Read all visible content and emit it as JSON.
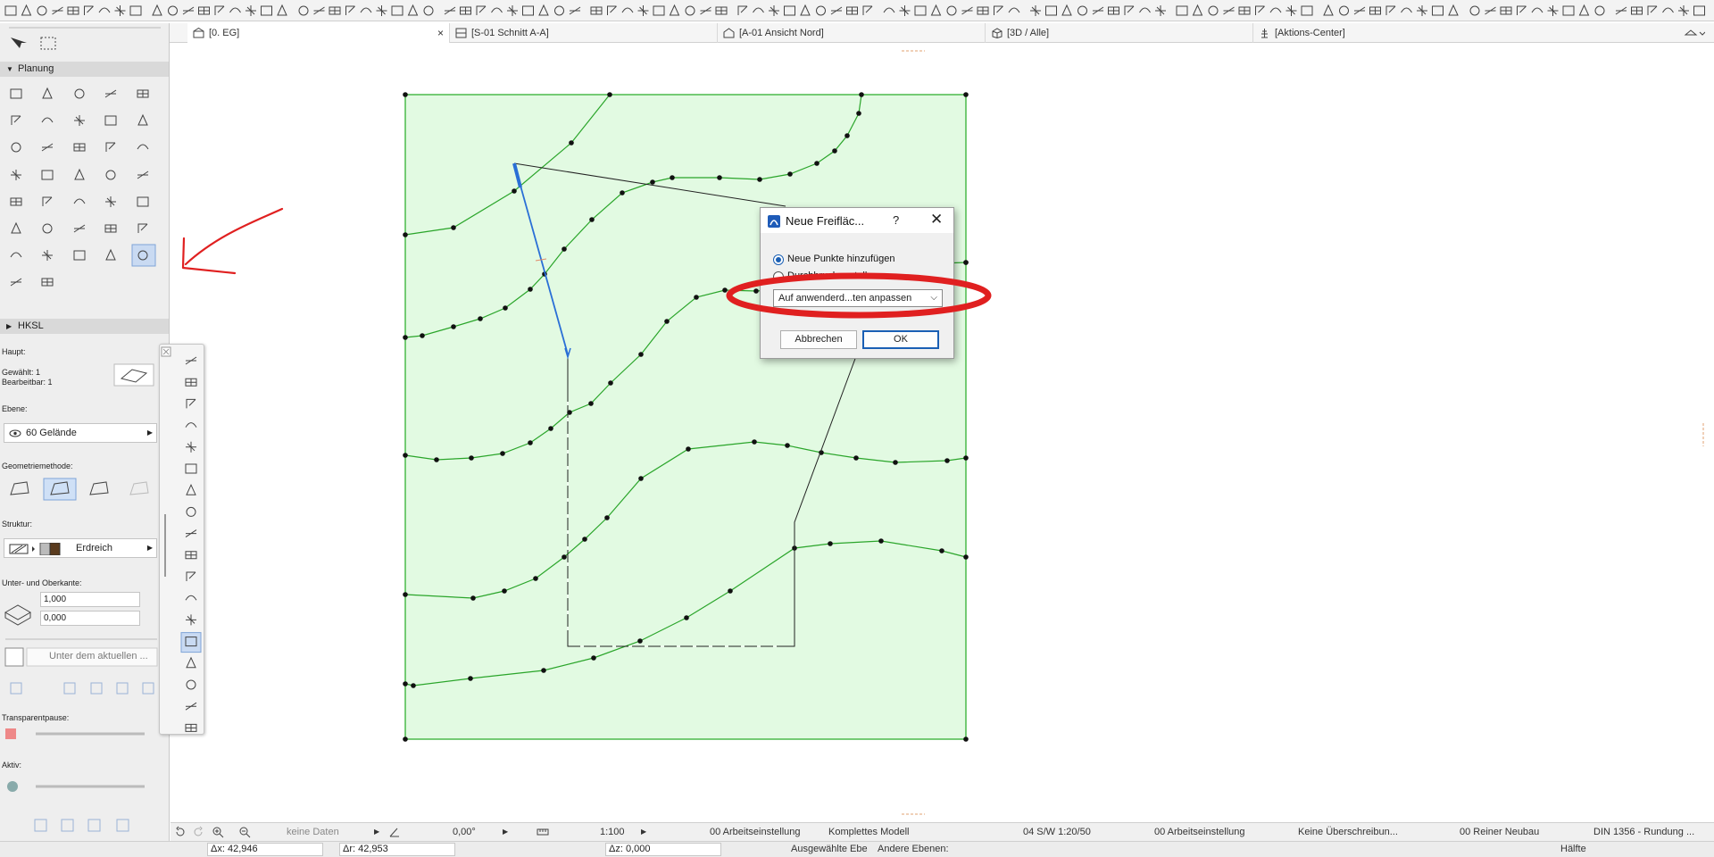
{
  "tabs": [
    {
      "label": "[0. EG]",
      "icon": "floor-plan-icon",
      "active": true,
      "close": "×"
    },
    {
      "label": "[S-01 Schnitt A-A]",
      "icon": "section-icon",
      "active": false
    },
    {
      "label": "[A-01 Ansicht Nord]",
      "icon": "elevation-icon",
      "active": false
    },
    {
      "label": "[3D / Alle]",
      "icon": "3d-view-icon",
      "active": false
    },
    {
      "label": "[Aktions-Center]",
      "icon": "action-center-icon",
      "active": false
    }
  ],
  "toolbox": {
    "section_planung": "Planung",
    "section_hksl": "HKSL",
    "haupt_label": "Haupt:",
    "gewaehlt": "Gewählt: 1",
    "bearbeitbar": "Bearbeitbar: 1",
    "ebene_label": "Ebene:",
    "ebene_value": "60 Gelände",
    "geometrie_label": "Geometriemethode:",
    "struktur_label": "Struktur:",
    "struktur_value": "Erdreich",
    "kante_label": "Unter- und Oberkante:",
    "unterkante": "1,000",
    "oberkante": "0,000",
    "placement_text": "Unter dem aktuellen ...",
    "transparent_label": "Transparentpause:",
    "aktiv_label": "Aktiv:"
  },
  "dialog": {
    "title": "Neue Freifläc...",
    "help": "?",
    "close": "✕",
    "option1": "Neue Punkte hinzufügen",
    "option2": "Durchbruch erstellen",
    "dropdown_value": "Auf anwenderd...ten anpassen",
    "cancel": "Abbrechen",
    "ok": "OK"
  },
  "status_bar": {
    "data": "keine Daten",
    "angle": "0,00°",
    "scale": "1:100",
    "layer_combo": "00 Arbeitseinstellung",
    "model_view": "Komplettes Modell",
    "pen_set": "04 S/W 1:20/50",
    "model_view_option": "00 Arbeitseinstellung",
    "override": "Keine Überschreibun...",
    "renovation": "00 Reiner Neubau",
    "dimension": "DIN 1356 - Rundung ..."
  },
  "coord_bar": {
    "dx": "Δx: 42,946",
    "dy": "Δr: 42,953",
    "dz": "Δz: 0,000",
    "selected_layers": "Ausgewählte Ebe",
    "other_layers": "Andere Ebenen:",
    "half": "Hälfte"
  },
  "colors": {
    "fill": "#e2fae2",
    "contour": "#2aa52a",
    "boundary": "#3fb53f",
    "annotation": "#e02020",
    "selection": "#2a6fd6"
  }
}
